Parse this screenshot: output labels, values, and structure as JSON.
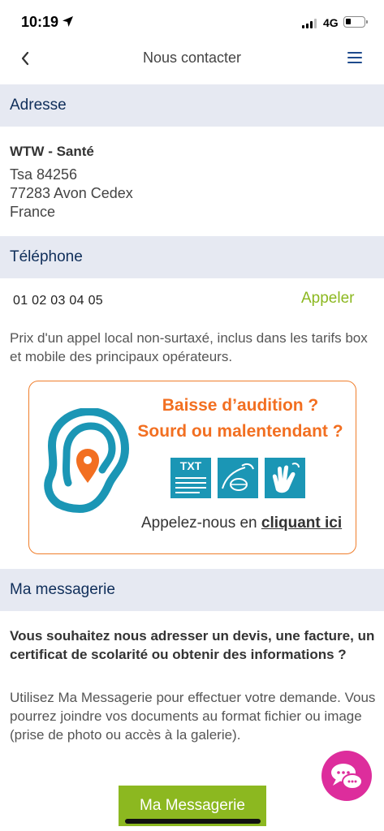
{
  "status_bar": {
    "time": "10:19",
    "network": "4G"
  },
  "nav": {
    "title": "Nous contacter"
  },
  "sections": {
    "address": "Adresse",
    "phone": "Téléphone",
    "messaging": "Ma messagerie"
  },
  "address": {
    "name": "WTW - Santé",
    "lines": [
      "Tsa 84256",
      "77283 Avon Cedex",
      "France"
    ]
  },
  "phone": {
    "number": "01 02 03 04 05",
    "call_label": "Appeler",
    "note": "Prix d'un appel local non-surtaxé, inclus dans les tarifs box et mobile des principaux opérateurs."
  },
  "audition": {
    "title_line1": "Baisse d’audition ?",
    "title_line2": "Sourd ou malentendant ?",
    "txt_label": "TXT",
    "cta_prefix": "Appelez-nous en ",
    "cta_link": "cliquant ici"
  },
  "messaging": {
    "intro": "Vous souhaitez nous adresser un devis, une facture, un certificat de scolarité  ou obtenir des informations ?",
    "description": "Utilisez Ma Messagerie pour effectuer votre demande. Vous pourrez joindre vos documents au format fichier ou image (prise de photo ou accès à la galerie).",
    "button_label": "Ma Messagerie"
  },
  "colors": {
    "section_bg": "#e6e9f2",
    "section_text": "#0f2e5a",
    "accent_green": "#8cb820",
    "audition_orange": "#f26f21",
    "audition_teal": "#1b96b5",
    "chat_pink": "#dd2d9c"
  },
  "icons": {
    "back": "chevron-left-icon",
    "menu": "hamburger-menu-icon",
    "ear": "ear-location-icon",
    "txt": "txt-relay-icon",
    "speech": "speech-reading-icon",
    "sign": "sign-language-icon",
    "chat": "chat-bubbles-icon"
  }
}
